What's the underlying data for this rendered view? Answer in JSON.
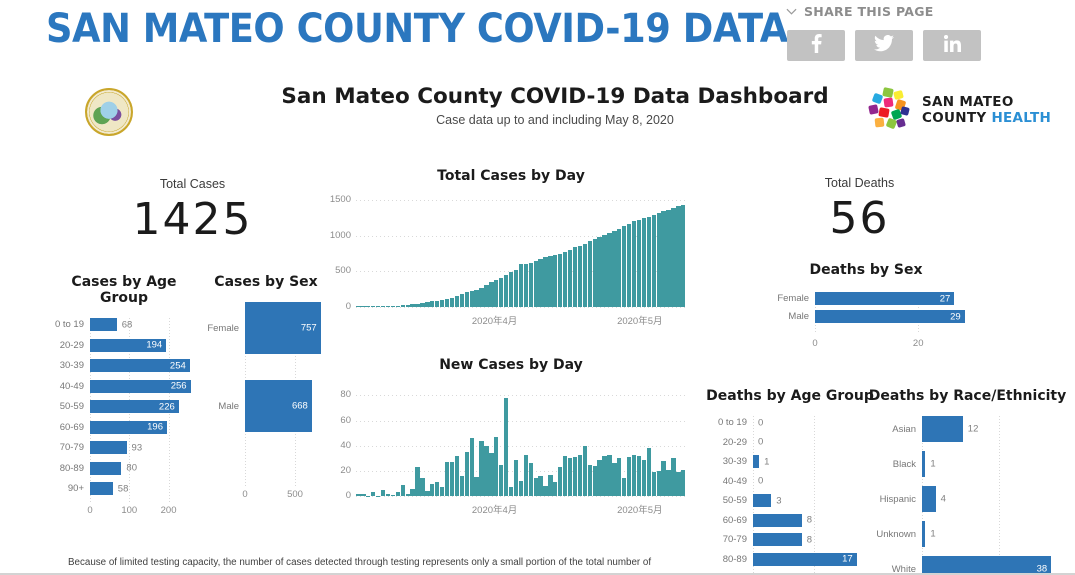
{
  "header": {
    "site_title": "SAN MATEO COUNTY COVID-19 DATA",
    "share_label": "SHARE THIS PAGE",
    "share_buttons": [
      {
        "name": "facebook",
        "label": "f"
      },
      {
        "name": "twitter",
        "label": "t"
      },
      {
        "name": "linkedin",
        "label": "in"
      }
    ],
    "dashboard_title": "San Mateo County COVID-19 Data Dashboard",
    "dashboard_subtitle": "Case data up to and including May 8, 2020",
    "org_line1": "SAN MATEO",
    "org_line2_a": "COUNTY ",
    "org_line2_b": "HEALTH"
  },
  "colors": {
    "title_blue": "#2b77bf",
    "bar_blue": "#2e75b6",
    "bar_teal": "#3f9aa0",
    "share_gray": "#c2c2c2"
  },
  "kpis": {
    "total_cases_label": "Total Cases",
    "total_cases_value": "1425",
    "total_deaths_label": "Total Deaths",
    "total_deaths_value": "56"
  },
  "footnote": "Because of limited testing capacity, the number of cases detected through testing represents only a small portion of the total number of",
  "chart_data": [
    {
      "id": "cases_by_age_group",
      "type": "bar",
      "orientation": "horizontal",
      "title": "Cases by Age Group",
      "categories": [
        "0 to 19",
        "20-29",
        "30-39",
        "40-49",
        "50-59",
        "60-69",
        "70-79",
        "80-89",
        "90+"
      ],
      "values": [
        68,
        194,
        254,
        256,
        226,
        196,
        93,
        80,
        58
      ],
      "xlabel": "",
      "ylabel": "",
      "xlim": [
        0,
        280
      ],
      "xticks": [
        0,
        100,
        200
      ],
      "grid": true,
      "color": "#2e75b6"
    },
    {
      "id": "cases_by_sex",
      "type": "bar",
      "orientation": "horizontal",
      "title": "Cases by Sex",
      "categories": [
        "Female",
        "Male"
      ],
      "values": [
        757,
        668
      ],
      "xlabel": "",
      "ylabel": "",
      "xlim": [
        0,
        820
      ],
      "xticks": [
        0,
        500
      ],
      "grid": true,
      "color": "#2e75b6"
    },
    {
      "id": "total_cases_by_day",
      "type": "bar",
      "orientation": "vertical",
      "title": "Total Cases by Day",
      "ylabel": "",
      "xlabel": "",
      "ylim": [
        0,
        1500
      ],
      "yticks": [
        0,
        500,
        1000,
        1500
      ],
      "xticks_labels": [
        "2020年4月",
        "2020年5月"
      ],
      "grid": true,
      "color": "#3f9aa0",
      "values": [
        2,
        4,
        4,
        4,
        8,
        14,
        15,
        17,
        21,
        24,
        34,
        39,
        49,
        57,
        69,
        80,
        88,
        100,
        107,
        134,
        161,
        177,
        212,
        228,
        244,
        274,
        306,
        345,
        379,
        413,
        448,
        495,
        520,
        598,
        605,
        612,
        645,
        678,
        704,
        717,
        733,
        749,
        772,
        796,
        836,
        861,
        890,
        922,
        948,
        981,
        1007,
        1040,
        1068,
        1100,
        1133,
        1162,
        1201,
        1223,
        1245,
        1266,
        1294,
        1315,
        1345,
        1365,
        1395,
        1415,
        1425
      ]
    },
    {
      "id": "new_cases_by_day",
      "type": "bar",
      "orientation": "vertical",
      "title": "New Cases by Day",
      "ylabel": "",
      "xlabel": "",
      "ylim": [
        0,
        85
      ],
      "yticks": [
        0,
        20,
        40,
        60,
        80
      ],
      "xticks_labels": [
        "2020年4月",
        "2020年5月"
      ],
      "grid": true,
      "color": "#3f9aa0",
      "values": [
        2,
        2,
        0,
        3,
        0,
        5,
        2,
        1,
        3,
        9,
        2,
        6,
        23,
        14,
        4,
        10,
        11,
        7,
        27,
        27,
        32,
        16,
        35,
        46,
        15,
        44,
        40,
        34,
        47,
        25,
        78,
        7,
        29,
        12,
        33,
        26,
        14,
        16,
        8,
        17,
        11,
        23,
        32,
        30,
        31,
        33,
        40,
        25,
        24,
        29,
        32,
        33,
        26,
        30,
        14,
        31,
        33,
        32,
        29,
        38,
        19,
        20,
        28,
        21,
        30,
        19,
        21
      ]
    },
    {
      "id": "deaths_by_sex",
      "type": "bar",
      "orientation": "horizontal",
      "title": "Deaths by Sex",
      "categories": [
        "Female",
        "Male"
      ],
      "values": [
        27,
        29
      ],
      "xlim": [
        0,
        31
      ],
      "xticks": [
        0,
        20
      ],
      "grid": true,
      "color": "#2e75b6"
    },
    {
      "id": "deaths_by_age_group",
      "type": "bar",
      "orientation": "horizontal",
      "title": "Deaths by Age Group",
      "categories": [
        "0 to 19",
        "20-29",
        "30-39",
        "40-49",
        "50-59",
        "60-69",
        "70-79",
        "80-89"
      ],
      "values": [
        0,
        0,
        1,
        0,
        3,
        8,
        8,
        17
      ],
      "xlim": [
        0,
        20
      ],
      "grid": true,
      "color": "#2e75b6"
    },
    {
      "id": "deaths_by_race_ethnicity",
      "type": "bar",
      "orientation": "horizontal",
      "title": "Deaths by Race/Ethnicity",
      "categories": [
        "Asian",
        "Black",
        "Hispanic",
        "Unknown",
        "White"
      ],
      "values": [
        12,
        1,
        4,
        1,
        38
      ],
      "xlim": [
        0,
        45
      ],
      "grid": true,
      "color": "#2e75b6"
    }
  ]
}
